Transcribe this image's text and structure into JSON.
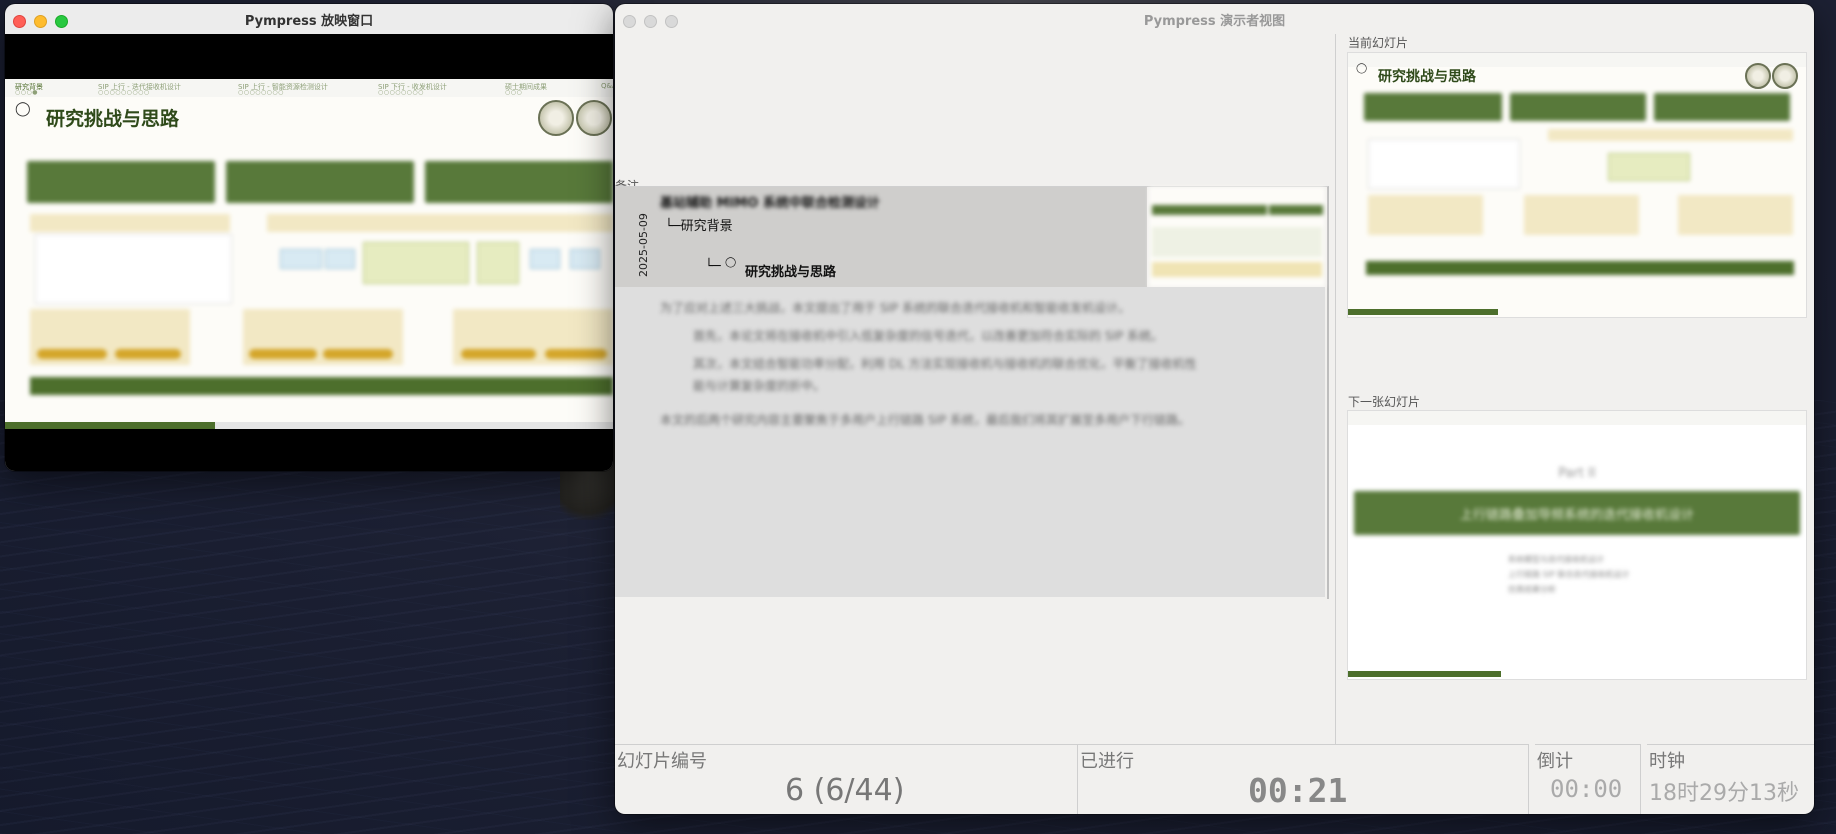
{
  "projector": {
    "title": "Pympress 放映窗口"
  },
  "slide": {
    "nav_sections": [
      "研究背景",
      "SIP 上行 - 迭代接收机设计",
      "SIP 上行 - 智能资源检测设计",
      "SIP 下行 - 收发机设计",
      "硕士期间成果",
      "Q&A"
    ],
    "nav_dots": [
      "○○○●",
      "○○○○○○○○○",
      "○○○○○○○○",
      "○○○○○○○○",
      "○○○",
      "○"
    ],
    "title": "研究挑战与思路"
  },
  "presenter": {
    "title": "Pympress 演示者视图",
    "notes_label": "备注",
    "date": "2025-05-09",
    "tree_root": "基站辅助 MIMO 系统中联合检测设计",
    "tree_level1": "└─研究背景",
    "tree_level2_prefix": "└─",
    "tree_level2": "研究挑战与思路",
    "notes_lines": [
      "为了应对上述三大挑战，本文提出了用于 SIP 系统的联合迭代接收机和智能收发机设计。",
      "首先，本论文将在接收机中引入低复杂度的信号迭代，以改善更加符合实际的 SIP 系统。",
      "其次，本文结合智能功率分配，利用 DL 方法实现接收机与接收机的联合优化，平衡了接收机性",
      "能与计算复杂度的折中。",
      "本文的后两个研究内容主要聚焦于多用户上行链路 SIP 系统，最后我们将其扩展至多用户下行链路。"
    ],
    "current_slide_label": "当前幻灯片",
    "next_slide_label": "下一张幻灯片",
    "next_slide": {
      "part": "Part II",
      "banner": "上行链路叠加导频系统的迭代接收机设计",
      "bullets": [
        "系统模型与迭代接收机设计",
        "上行链路 SIP 联合迭代接收机设计",
        "仿真结果分析"
      ]
    }
  },
  "status": {
    "slide_number_label": "幻灯片编号",
    "slide_number_value": "6 (6/44)",
    "elapsed_label": "已进行",
    "elapsed_value": "00:21",
    "countdown_label": "倒计",
    "countdown_value": "00:00",
    "clock_label": "时钟",
    "clock_value": "18时29分13秒"
  },
  "colors": {
    "accent_green": "#58793a",
    "accent_gold": "#d4a62a",
    "close": "#ff5f57",
    "minimize": "#febc2e",
    "zoom": "#28c840"
  }
}
